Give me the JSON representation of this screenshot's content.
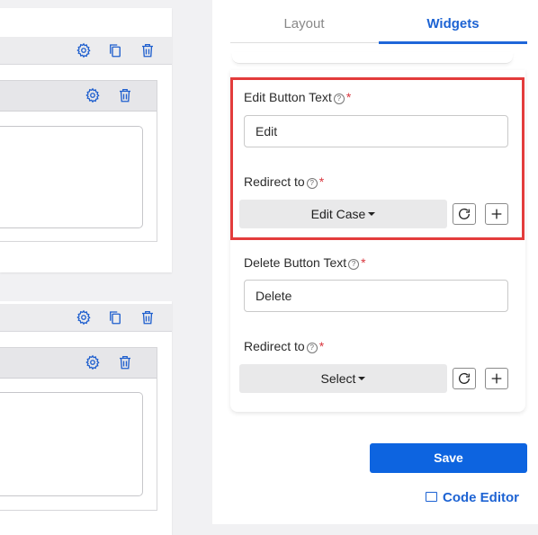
{
  "tabs": [
    {
      "label": "Layout",
      "active": false
    },
    {
      "label": "Widgets",
      "active": true
    }
  ],
  "form": {
    "edit_button_text": {
      "label": "Edit Button Text",
      "required_mark": "*",
      "value": "Edit"
    },
    "edit_redirect": {
      "label": "Redirect to",
      "required_mark": "*",
      "selected": "Edit Case"
    },
    "delete_button_text": {
      "label": "Delete Button Text",
      "required_mark": "*",
      "value": "Delete"
    },
    "delete_redirect": {
      "label": "Redirect to",
      "required_mark": "*",
      "selected": "Select"
    }
  },
  "help_glyph": "?",
  "save_label": "Save",
  "code_editor_label": "Code Editor",
  "colors": {
    "accent": "#0d64e0",
    "highlight": "#e33c3c",
    "required": "#d9363e",
    "icon": "#1f5fce"
  }
}
